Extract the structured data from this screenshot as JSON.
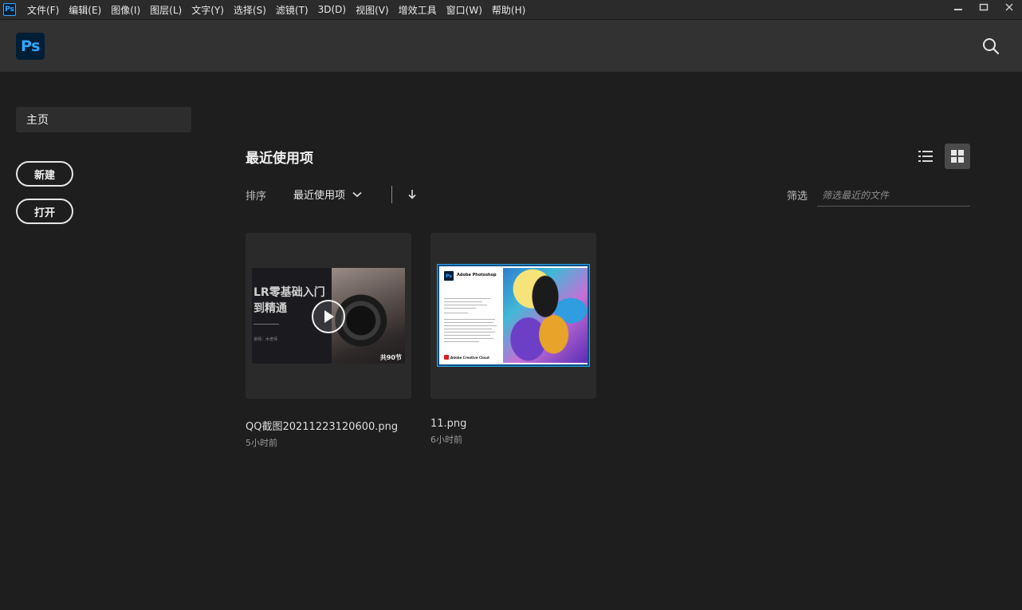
{
  "menubar": {
    "app_icon": "Ps",
    "items": [
      "文件(F)",
      "编辑(E)",
      "图像(I)",
      "图层(L)",
      "文字(Y)",
      "选择(S)",
      "滤镜(T)",
      "3D(D)",
      "视图(V)",
      "增效工具",
      "窗口(W)",
      "帮助(H)"
    ]
  },
  "header": {
    "logo": "Ps",
    "search_icon": "search-icon"
  },
  "sidebar": {
    "home": "主页",
    "new_button": "新建",
    "open_button": "打开"
  },
  "main": {
    "title": "最近使用项",
    "sort": {
      "label": "排序",
      "selected": "最近使用项",
      "direction_icon": "arrow-down-icon"
    },
    "filter": {
      "label": "筛选",
      "placeholder": "筛选最近的文件"
    },
    "files": [
      {
        "name": "QQ截图20211223120600.png",
        "time": "5小时前",
        "thumb": {
          "line1": "LR零基础入门",
          "line2": "到精通",
          "small": "讲师：木老师",
          "badge": "共90节"
        }
      },
      {
        "name": "11.png",
        "time": "6小时前",
        "thumb": {
          "title": "Adobe Photoshop",
          "footer": "Adobe Creative Cloud"
        }
      }
    ]
  },
  "colors": {
    "background": "#1e1e1e",
    "header": "#323232",
    "accent": "#31a8ff",
    "logo_bg": "#001e36"
  }
}
